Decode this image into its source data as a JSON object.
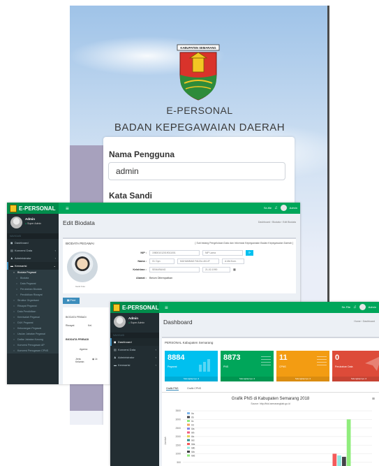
{
  "login": {
    "logo_text": "KABUPATEN SEMARANG",
    "title": "E-PERSONAL",
    "subtitle": "BADAN KEPEGAWAIAN DAERAH",
    "username_label": "Nama Pengguna",
    "username_value": "admin",
    "password_label": "Kata Sandi"
  },
  "biodata_window": {
    "brand": "E-PERSONAL",
    "topbar": {
      "notif": "Se-file",
      "user": "Admin"
    },
    "user": {
      "name": "Admin",
      "status": "Super Admin"
    },
    "nav_header": "NAVIGASI",
    "nav": [
      {
        "label": "Dashboard",
        "icon": "dashboard-icon",
        "active": false,
        "arrow": ""
      },
      {
        "label": "Konversi Data",
        "icon": "database-icon",
        "active": false,
        "arrow": "‹"
      },
      {
        "label": "Administrator",
        "icon": "user-icon",
        "active": false,
        "arrow": "‹"
      },
      {
        "label": "Kenwarisi",
        "icon": "folder-icon",
        "active": true,
        "arrow": "‹"
      }
    ],
    "subnav": [
      {
        "label": "Biodata Pegawai",
        "strong": true
      },
      {
        "label": "Biodata",
        "strong": false
      },
      {
        "label": "Data Pegawai",
        "strong": false
      },
      {
        "label": "Perubahan Biodata",
        "strong": false
      },
      {
        "label": "Pendidikan Riwayat",
        "strong": false
      },
      {
        "label": "Struktur Organisasi",
        "strong": true
      },
      {
        "label": "Riwayat Pegawai",
        "strong": true
      },
      {
        "label": "Data Pendidikan",
        "strong": true
      },
      {
        "label": "Kenrisalah Pegawai",
        "strong": true
      },
      {
        "label": "DUK Pegawai",
        "strong": true
      },
      {
        "label": "Kekurangan Pegawai",
        "strong": true
      },
      {
        "label": "Usulan Jabatan Pegawai",
        "strong": true
      },
      {
        "label": "Daftar Jabatan Kosong",
        "strong": true
      },
      {
        "label": "Konversi Penugasan AP",
        "strong": true
      },
      {
        "label": "Konversi Penugasan CPNS",
        "strong": true
      }
    ],
    "page_title": "Edit Biodata",
    "breadcrumb": "Dashboard › Biodata › Edit Biodata",
    "box_title": "BIODATA PEGAWAI",
    "note": "[ Sub bidang Pengelolaan Data dan Informasi Kepegawaian Badan Kepegawaian Daerah ]",
    "photo_caption": "Ganti Foto",
    "fields": {
      "nip_label": "NIP :",
      "nip_value": "198001012019011001",
      "nip_lama_placeholder": "NIP Lama",
      "nama_label": "Nama :",
      "gelar_depan": "Gl. Dpn",
      "nama_value": "MUHAMMAD FAIZAL AKLIF",
      "gelar_belakang": "A.Md.Kom.",
      "kelahiran_label": "Kelahiran :",
      "tempat_lahir": "SEMARANG",
      "tanggal_lahir": "21-02-1990",
      "alamat_label": "Alamat :",
      "alamat_value": "Belum Ditempatkan"
    },
    "print_button": "Print",
    "lower": {
      "tab_biodata": "BIODATA PRIBADI",
      "tab_riwayat": "Riwayat",
      "tab_kel": "Kel.",
      "section": "BIODATA PRIBADI",
      "agama_label": "Agama:",
      "jk_label": "Jenis Kelamin:",
      "jk_value": "Lk"
    }
  },
  "dashboard_window": {
    "brand": "E-PERSONAL",
    "topbar": {
      "notif": "Se-File",
      "user": "Admin"
    },
    "user": {
      "name": "Admin",
      "status": "Super Admin"
    },
    "nav_header": "NAVIGASI",
    "nav": [
      {
        "label": "Dashboard",
        "icon": "dashboard-icon",
        "active": true,
        "arrow": ""
      },
      {
        "label": "Konversi Data",
        "icon": "database-icon",
        "active": false,
        "arrow": "‹"
      },
      {
        "label": "Administrator",
        "icon": "user-icon",
        "active": false,
        "arrow": "‹"
      },
      {
        "label": "Kenwarisi",
        "icon": "folder-icon",
        "active": false,
        "arrow": "‹"
      }
    ],
    "page_title": "Dashboard",
    "breadcrumb": "Home › Dashboard",
    "box_title": "PERSONAL Kabupaten Semarang",
    "stats": [
      {
        "value": "8884",
        "label": "Pegawai",
        "footer": "Selengkapnya",
        "color": "#00c0ef"
      },
      {
        "value": "8873",
        "label": "PNS",
        "footer": "Selengkapnya",
        "color": "#00a65a"
      },
      {
        "value": "11",
        "label": "CPNS",
        "footer": "Selengkapnya",
        "color": "#f39c12"
      },
      {
        "value": "0",
        "label": "Perubahan Data",
        "footer": "Selengkapnya",
        "color": "#dd4b39"
      }
    ],
    "tabs": [
      "Grafik PNS",
      "Grafik CPNS"
    ],
    "menu_icon": "≡"
  },
  "chart_data": {
    "type": "bar",
    "title": "Grafik PNS di Kabupaten Semarang 2018",
    "subtitle": "Source: http://bkd.semarangkab.go.id",
    "ylabel": "Jumlah",
    "yticks": [
      "3500",
      "3000",
      "2500",
      "2000",
      "1500",
      "1000",
      "500"
    ],
    "ylim": [
      0,
      3500
    ],
    "legend": [
      "I/a",
      "I/b",
      "I/c",
      "I/d",
      "II/a",
      "II/b",
      "II/c",
      "II/d",
      "III/a",
      "III/b",
      "III/c",
      "III/d"
    ],
    "series": [
      {
        "name": "I/a",
        "values": [
          10
        ],
        "color": "#7cb5ec"
      },
      {
        "name": "I/b",
        "values": [
          15
        ],
        "color": "#434348"
      },
      {
        "name": "I/c",
        "values": [
          20
        ],
        "color": "#90ed7d"
      },
      {
        "name": "I/d",
        "values": [
          25
        ],
        "color": "#f7a35c"
      },
      {
        "name": "II/a",
        "values": [
          60
        ],
        "color": "#8085e9"
      },
      {
        "name": "II/b",
        "values": [
          80
        ],
        "color": "#f15c80"
      },
      {
        "name": "II/c",
        "values": [
          160
        ],
        "color": "#e4d354"
      },
      {
        "name": "II/d",
        "values": [
          220
        ],
        "color": "#2b908f"
      },
      {
        "name": "III/a",
        "values": [
          1000
        ],
        "color": "#f45b5b"
      },
      {
        "name": "III/b",
        "values": [
          900
        ],
        "color": "#91e8e1"
      },
      {
        "name": "III/c",
        "values": [
          820
        ],
        "color": "#434348"
      },
      {
        "name": "III/d",
        "values": [
          3000
        ],
        "color": "#90ed7d"
      }
    ]
  }
}
